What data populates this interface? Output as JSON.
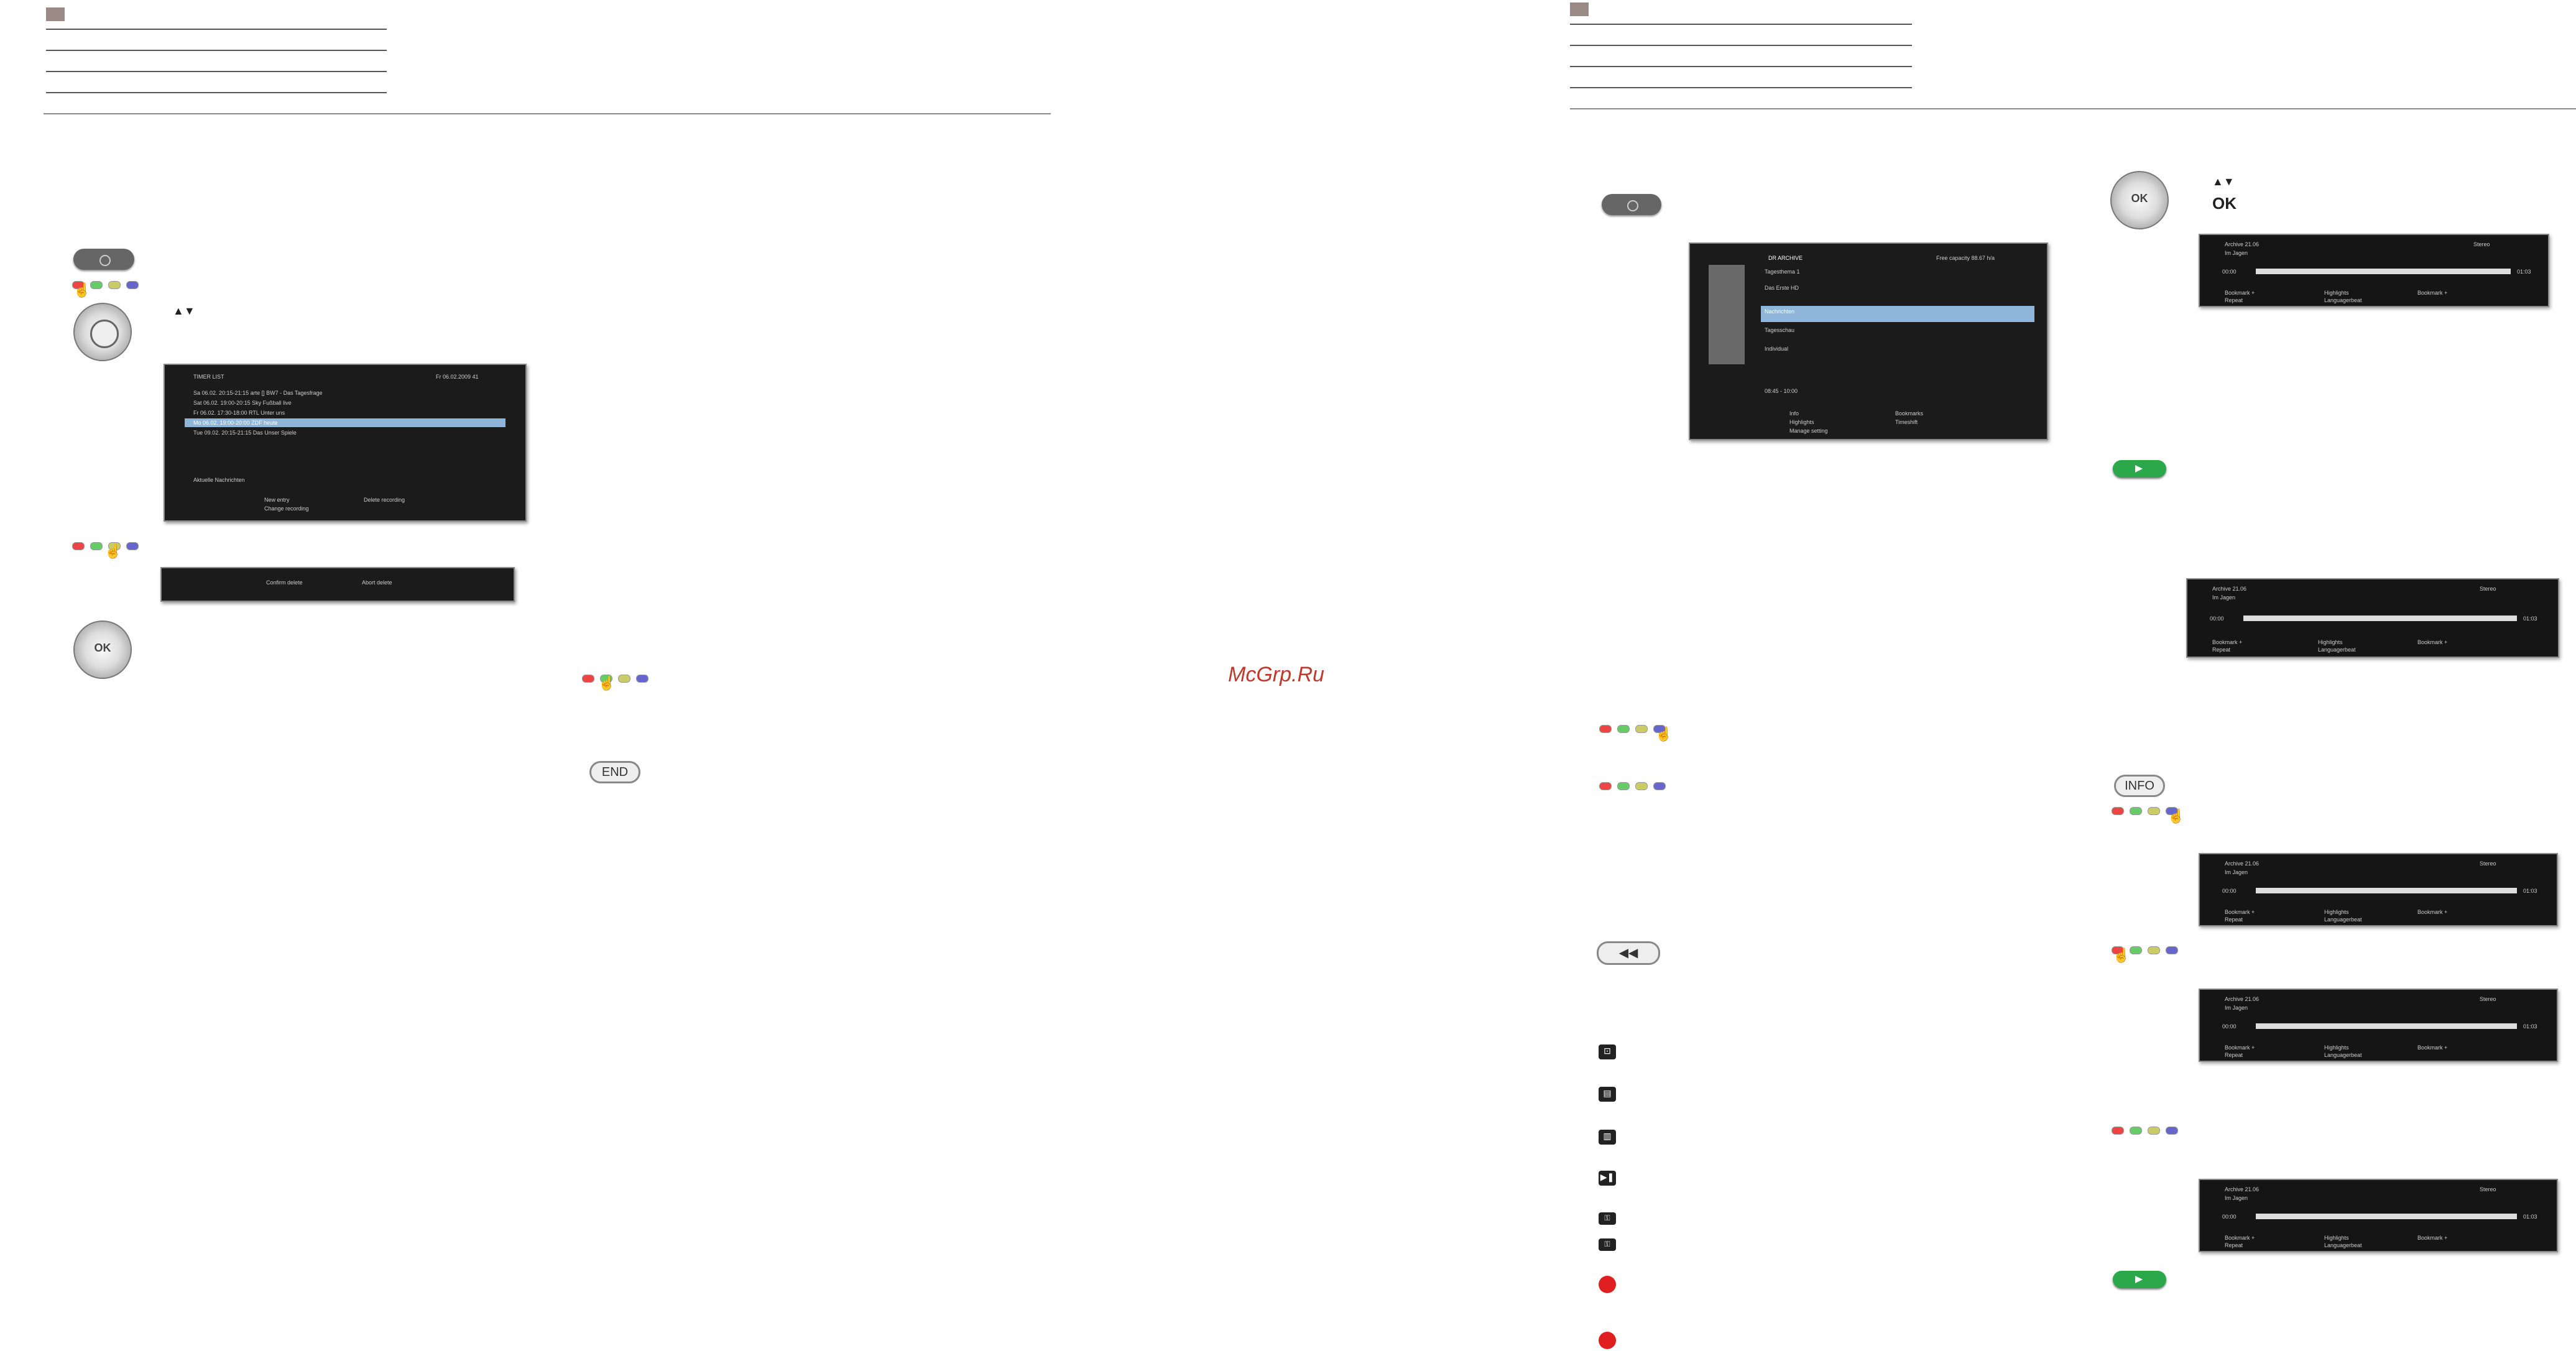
{
  "watermark": "McGrp.Ru",
  "left_page": {
    "timer_screen": {
      "title": "TIMER LIST",
      "clock": "Fr 06.02.2009 41",
      "rows": [
        "Sa  06.02.  20:15-21:15  arte      [] BW7 - Das Tagesfrage",
        "Sat 06.02.  19:00-20:15  Sky       Fußball live",
        "Fr  06.02.  17:30-18:00  RTL       Unter uns",
        "Mo  06.02.  19:00-20:00  ZDF       heute",
        "Tue 09.02.  20:15-21:15  Das       Unser Spiele"
      ],
      "footer_text": "Aktuelle Nachrichten",
      "legend": [
        "New entry",
        "Delete recording",
        "Change recording"
      ]
    },
    "confirm_bar": {
      "options": [
        "Confirm delete",
        "Abort delete"
      ]
    },
    "dpad_ok": "OK",
    "end_label": "END"
  },
  "right_page": {
    "archive_screen": {
      "title": "DR ARCHIVE",
      "capacity": "Free capacity 88.67 h/a",
      "items": [
        "Tagesthema 1",
        "Das Erste HD",
        "Nachrichten",
        "Tagesschau",
        "Individual"
      ],
      "time_range": "08:45 - 10:00",
      "legend": [
        "Info",
        "Bookmarks",
        "Highlights",
        "Timeshift",
        "Manage setting"
      ]
    },
    "ok_label": "OK",
    "info_label": "INFO",
    "player_bar": {
      "title": "Archive 21.06",
      "subtitle": "Im Jagen",
      "status": "Stereo",
      "start": "00:00",
      "end": "01:03",
      "legend": [
        "Bookmark +",
        "Highlights",
        "Bookmark +",
        "Repeat",
        "Languagerbeat"
      ]
    }
  }
}
